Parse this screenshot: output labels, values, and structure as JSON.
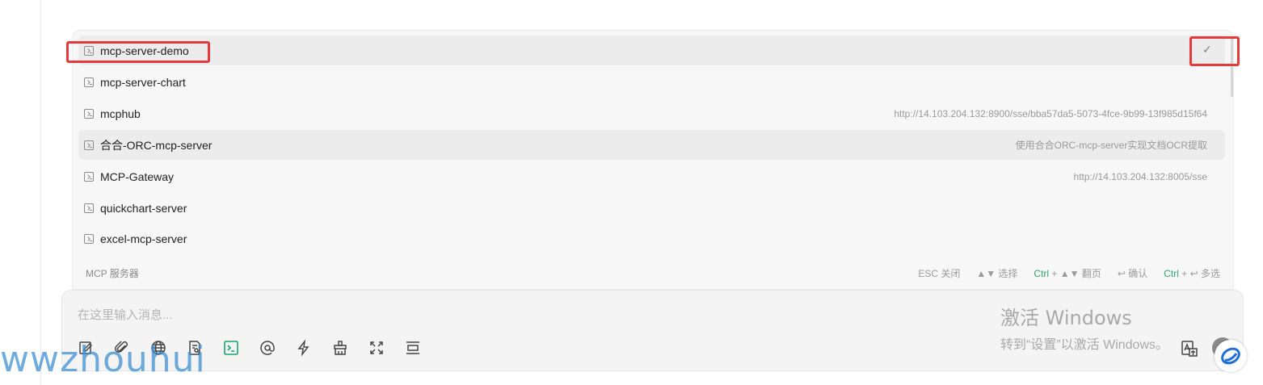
{
  "popup": {
    "items": [
      {
        "name": "mcp-server-demo",
        "desc": ""
      },
      {
        "name": "mcp-server-chart",
        "desc": ""
      },
      {
        "name": "mcphub",
        "desc": "http://14.103.204.132:8900/sse/bba57da5-5073-4fce-9b99-13f985d15f64"
      },
      {
        "name": "合合-ORC-mcp-server",
        "desc": "使用合合ORC-mcp-server实现文档OCR提取"
      },
      {
        "name": "MCP-Gateway",
        "desc": "http://14.103.204.132:8005/sse"
      },
      {
        "name": "quickchart-server",
        "desc": ""
      },
      {
        "name": "excel-mcp-server",
        "desc": ""
      }
    ],
    "footer_label": "MCP 服务器",
    "shortcuts": {
      "esc": "ESC 关闭",
      "select": "▲▼ 选择",
      "page_key": "Ctrl",
      "page_rest": " + ▲▼ 翻页",
      "confirm": "↩ 确认",
      "multi_key": "Ctrl",
      "multi_rest": " + ↩ 多选"
    },
    "selected_check": "✓"
  },
  "input": {
    "placeholder": "在这里输入消息..."
  },
  "windows": {
    "title": "激活 Windows",
    "subtitle": "转到“设置”以激活 Windows。"
  },
  "watermark": "wwzhouhui",
  "colors": {
    "accent_green": "#1aa36a",
    "highlight_red": "#e6393a"
  }
}
